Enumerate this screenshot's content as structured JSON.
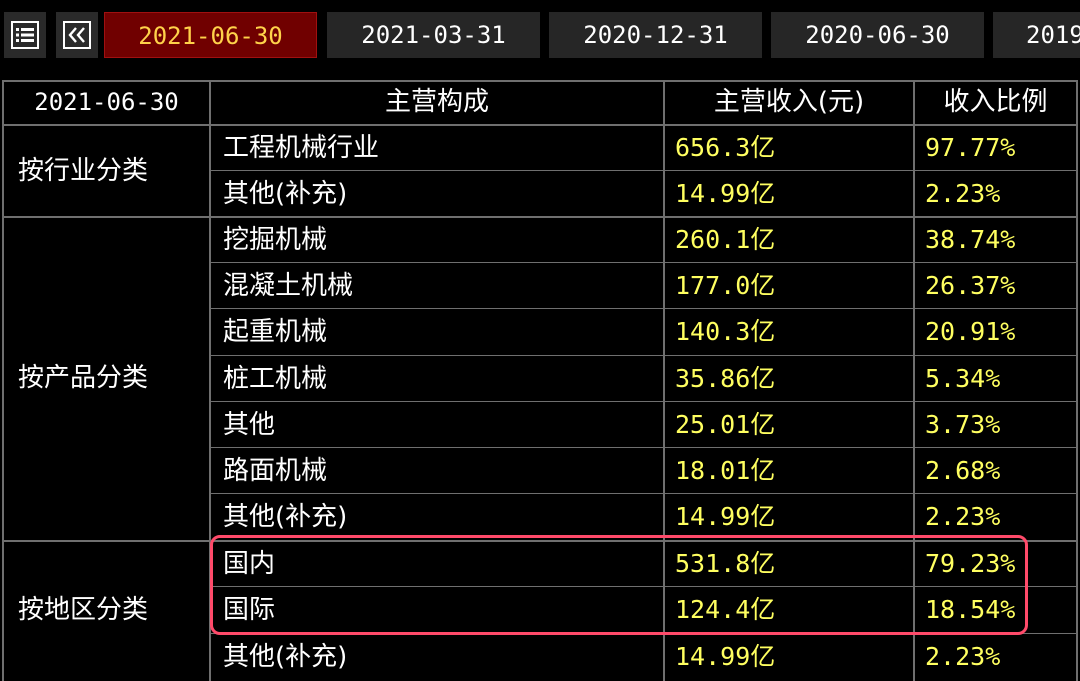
{
  "toolbar": {
    "tabs": [
      {
        "label": "2021-06-30",
        "active": true
      },
      {
        "label": "2021-03-31",
        "active": false
      },
      {
        "label": "2020-12-31",
        "active": false
      },
      {
        "label": "2020-06-30",
        "active": false
      },
      {
        "label": "2019",
        "active": false
      }
    ],
    "icons": [
      "list-icon",
      "double-chevron-left-icon"
    ]
  },
  "table": {
    "headers": {
      "period": "2021-06-30",
      "composition": "主营构成",
      "revenue": "主营收入(元)",
      "ratio": "收入比例"
    },
    "groups": [
      {
        "category": "按行业分类",
        "rows": [
          {
            "name": "工程机械行业",
            "revenue": "656.3亿",
            "ratio": "97.77%"
          },
          {
            "name": "其他(补充)",
            "revenue": "14.99亿",
            "ratio": "2.23%"
          }
        ]
      },
      {
        "category": "按产品分类",
        "rows": [
          {
            "name": "挖掘机械",
            "revenue": "260.1亿",
            "ratio": "38.74%"
          },
          {
            "name": "混凝土机械",
            "revenue": "177.0亿",
            "ratio": "26.37%"
          },
          {
            "name": "起重机械",
            "revenue": "140.3亿",
            "ratio": "20.91%"
          },
          {
            "name": "桩工机械",
            "revenue": "35.86亿",
            "ratio": "5.34%"
          },
          {
            "name": "其他",
            "revenue": "25.01亿",
            "ratio": "3.73%"
          },
          {
            "name": "路面机械",
            "revenue": "18.01亿",
            "ratio": "2.68%"
          },
          {
            "name": "其他(补充)",
            "revenue": "14.99亿",
            "ratio": "2.23%"
          }
        ]
      },
      {
        "category": "按地区分类",
        "rows": [
          {
            "name": "国内",
            "revenue": "531.8亿",
            "ratio": "79.23%"
          },
          {
            "name": "国际",
            "revenue": "124.4亿",
            "ratio": "18.54%"
          },
          {
            "name": "其他(补充)",
            "revenue": "14.99亿",
            "ratio": "2.23%"
          }
        ]
      }
    ]
  },
  "colors": {
    "background": "#000000",
    "active_tab_bg": "#700000",
    "active_tab_text": "#ffd24a",
    "tab_bg": "#262626",
    "grid_line": "#6f6f6f",
    "number_text": "#ffff60",
    "highlight_border": "#ff4a6a"
  }
}
